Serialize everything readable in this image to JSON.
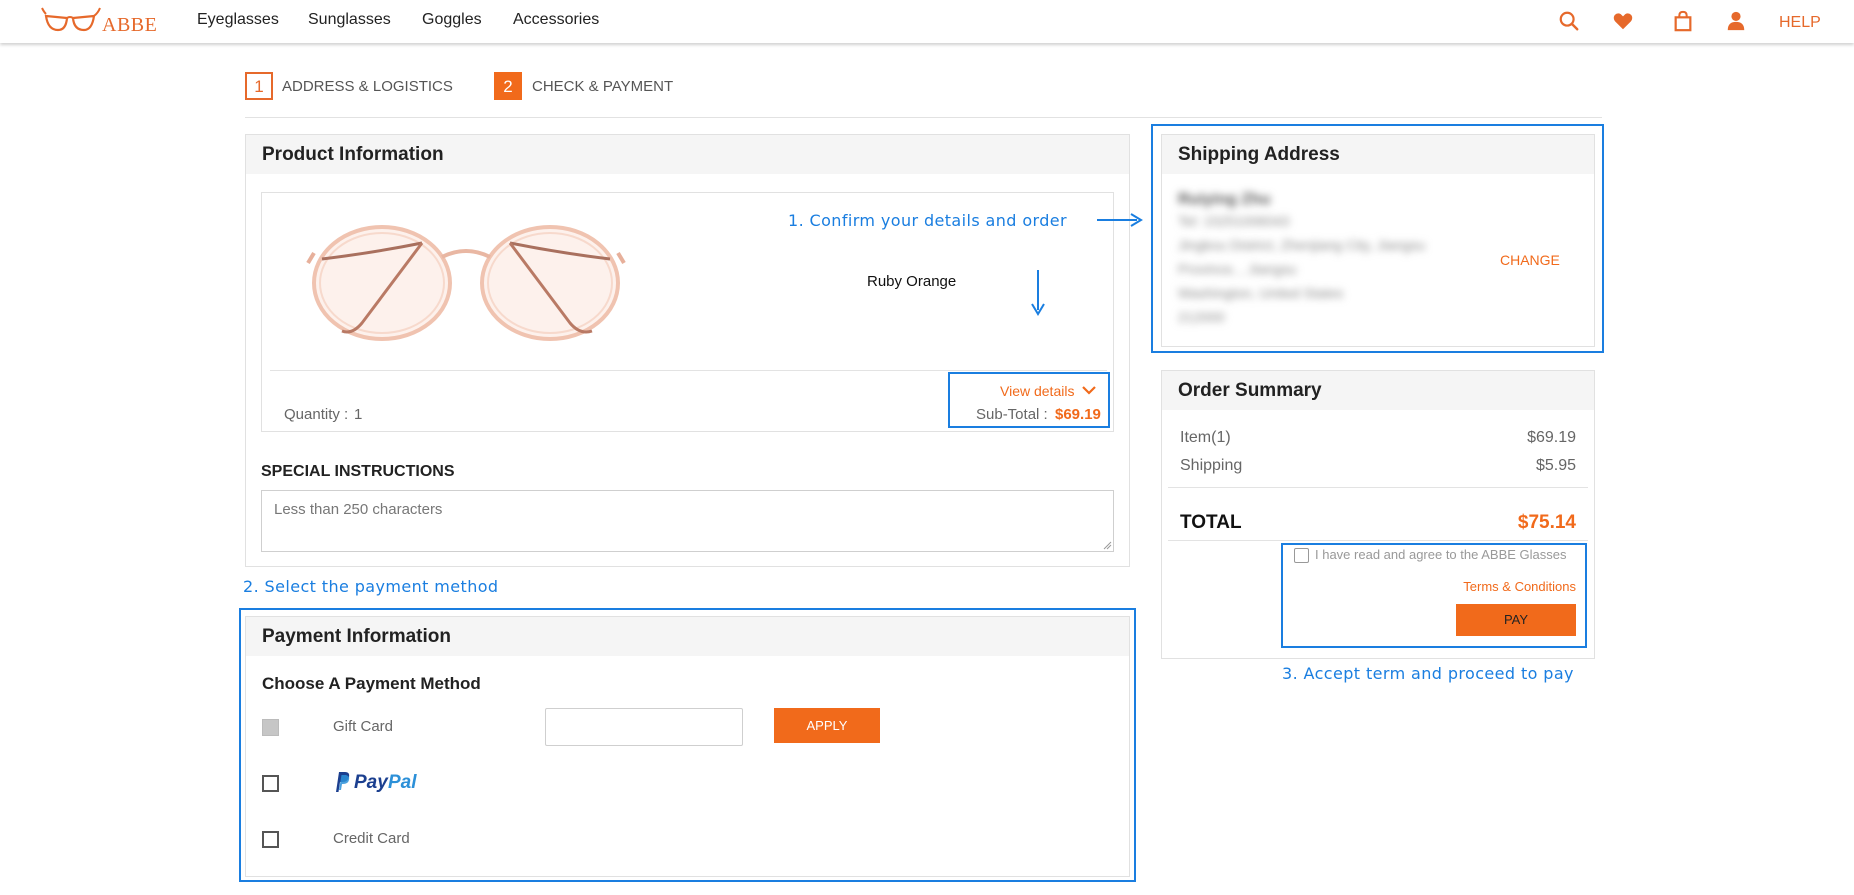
{
  "header": {
    "logo": "ABBE",
    "nav": [
      "Eyeglasses",
      "Sunglasses",
      "Goggles",
      "Accessories"
    ],
    "icons": [
      "search-icon",
      "heart-icon",
      "bag-icon",
      "user-icon"
    ],
    "help": "HELP"
  },
  "steps": [
    {
      "number": "1",
      "label": "ADDRESS & LOGISTICS"
    },
    {
      "number": "2",
      "label": "CHECK & PAYMENT"
    }
  ],
  "product": {
    "title": "Product Information",
    "color_name": "Ruby Orange",
    "quantity_label": "Quantity : ",
    "quantity": "1",
    "view_details": "View details",
    "subtotal_label": "Sub-Total : ",
    "subtotal": "$69.19"
  },
  "instructions": {
    "title": "SPECIAL INSTRUCTIONS",
    "placeholder": "Less than 250 characters"
  },
  "shipping": {
    "title": "Shipping Address",
    "name": "Ruiying Zhu",
    "lines": [
      "Tel: 15251006043",
      "Jingkou District, Zhenjiang City, Jiangsu",
      "Province, , Jiangsu",
      "Washington, United States",
      "212000"
    ],
    "change": "CHANGE"
  },
  "summary": {
    "title": "Order Summary",
    "rows": [
      {
        "label": "Item(1)",
        "value": "$69.19"
      },
      {
        "label": "Shipping",
        "value": "$5.95"
      }
    ],
    "total_label": "TOTAL",
    "total_value": "$75.14",
    "agree_text": "I have read and agree to the ABBE Glasses",
    "terms": "Terms & Conditions",
    "pay": "PAY"
  },
  "payment": {
    "title": "Payment Information",
    "subtitle": "Choose A Payment Method",
    "gift_card": "Gift Card",
    "apply": "APPLY",
    "paypal": {
      "pay": "Pay",
      "pal": "Pal"
    },
    "credit_card": "Credit Card"
  },
  "annotations": {
    "a1": "1. Confirm your details and order",
    "a2": "2. Select the payment method",
    "a3": "3. Accept term and proceed to pay"
  },
  "colors": {
    "accent": "#f16a1b",
    "annotation": "#1a7ee0"
  }
}
